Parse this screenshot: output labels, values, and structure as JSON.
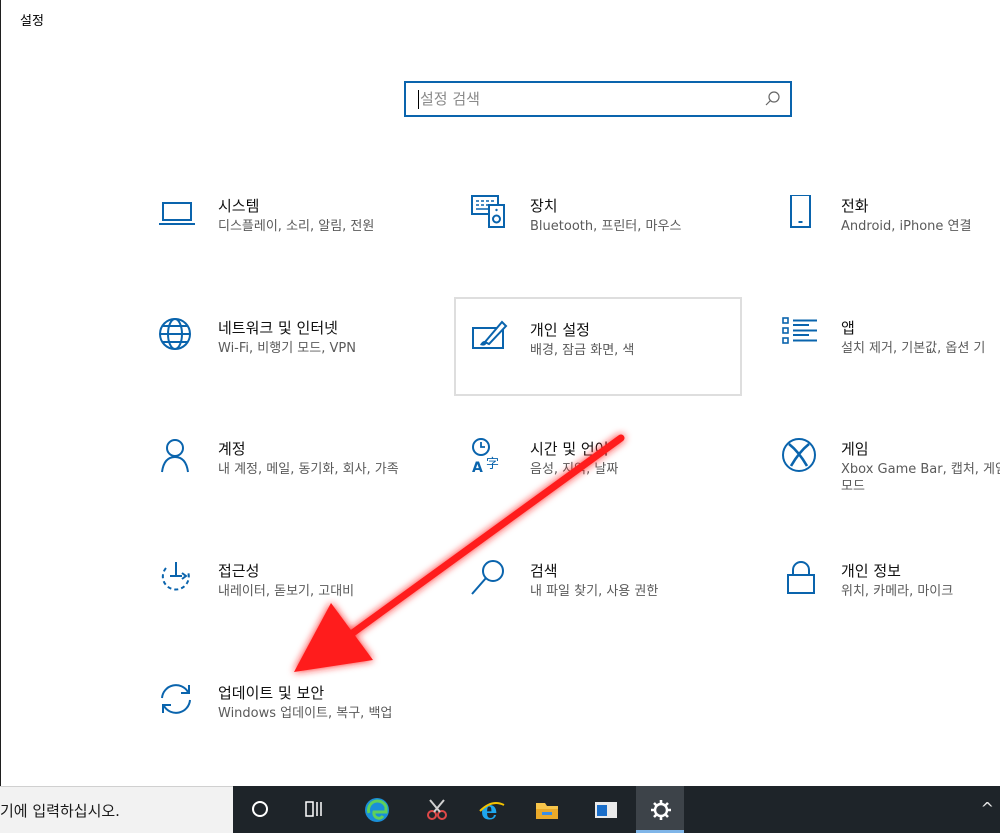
{
  "window": {
    "title": "설정"
  },
  "search": {
    "placeholder": "설정 검색"
  },
  "tiles": [
    {
      "title": "시스템",
      "subtitle": "디스플레이, 소리, 알림, 전원",
      "icon": "laptop-icon"
    },
    {
      "title": "장치",
      "subtitle": "Bluetooth, 프린터, 마우스",
      "icon": "devices-icon"
    },
    {
      "title": "전화",
      "subtitle": "Android, iPhone 연결",
      "icon": "phone-icon"
    },
    {
      "title": "네트워크 및 인터넷",
      "subtitle": "Wi-Fi, 비행기 모드, VPN",
      "icon": "globe-icon"
    },
    {
      "title": "개인 설정",
      "subtitle": "배경, 잠금 화면, 색",
      "icon": "personalization-icon"
    },
    {
      "title": "앱",
      "subtitle": "설치 제거, 기본값, 옵션 기",
      "icon": "apps-list-icon"
    },
    {
      "title": "계정",
      "subtitle": "내 계정, 메일, 동기화, 회사, 가족",
      "icon": "person-icon"
    },
    {
      "title": "시간 및 언어",
      "subtitle": "음성, 지역, 날짜",
      "icon": "time-language-icon"
    },
    {
      "title": "게임",
      "subtitle": "Xbox Game Bar, 캡처, 게임 모드",
      "icon": "xbox-icon"
    },
    {
      "title": "접근성",
      "subtitle": "내레이터, 돋보기, 고대비",
      "icon": "accessibility-icon"
    },
    {
      "title": "검색",
      "subtitle": "내 파일 찾기, 사용 권한",
      "icon": "search-icon"
    },
    {
      "title": "개인 정보",
      "subtitle": "위치, 카메라, 마이크",
      "icon": "lock-icon"
    },
    {
      "title": "업데이트 및 보안",
      "subtitle": "Windows 업데이트, 복구, 백업",
      "icon": "sync-icon"
    }
  ],
  "taskbar": {
    "search_text": "기에 입력하십시오.",
    "tray_label": "^",
    "icons": [
      "cortana-icon",
      "task-view-icon",
      "edge-icon",
      "snipping-tool-icon",
      "internet-explorer-icon",
      "file-explorer-icon",
      "app-window-icon",
      "settings-gear-icon"
    ]
  },
  "colors": {
    "accent": "#0a64ad",
    "arrow": "#ff1a1a",
    "taskbar": "#1e2429"
  }
}
